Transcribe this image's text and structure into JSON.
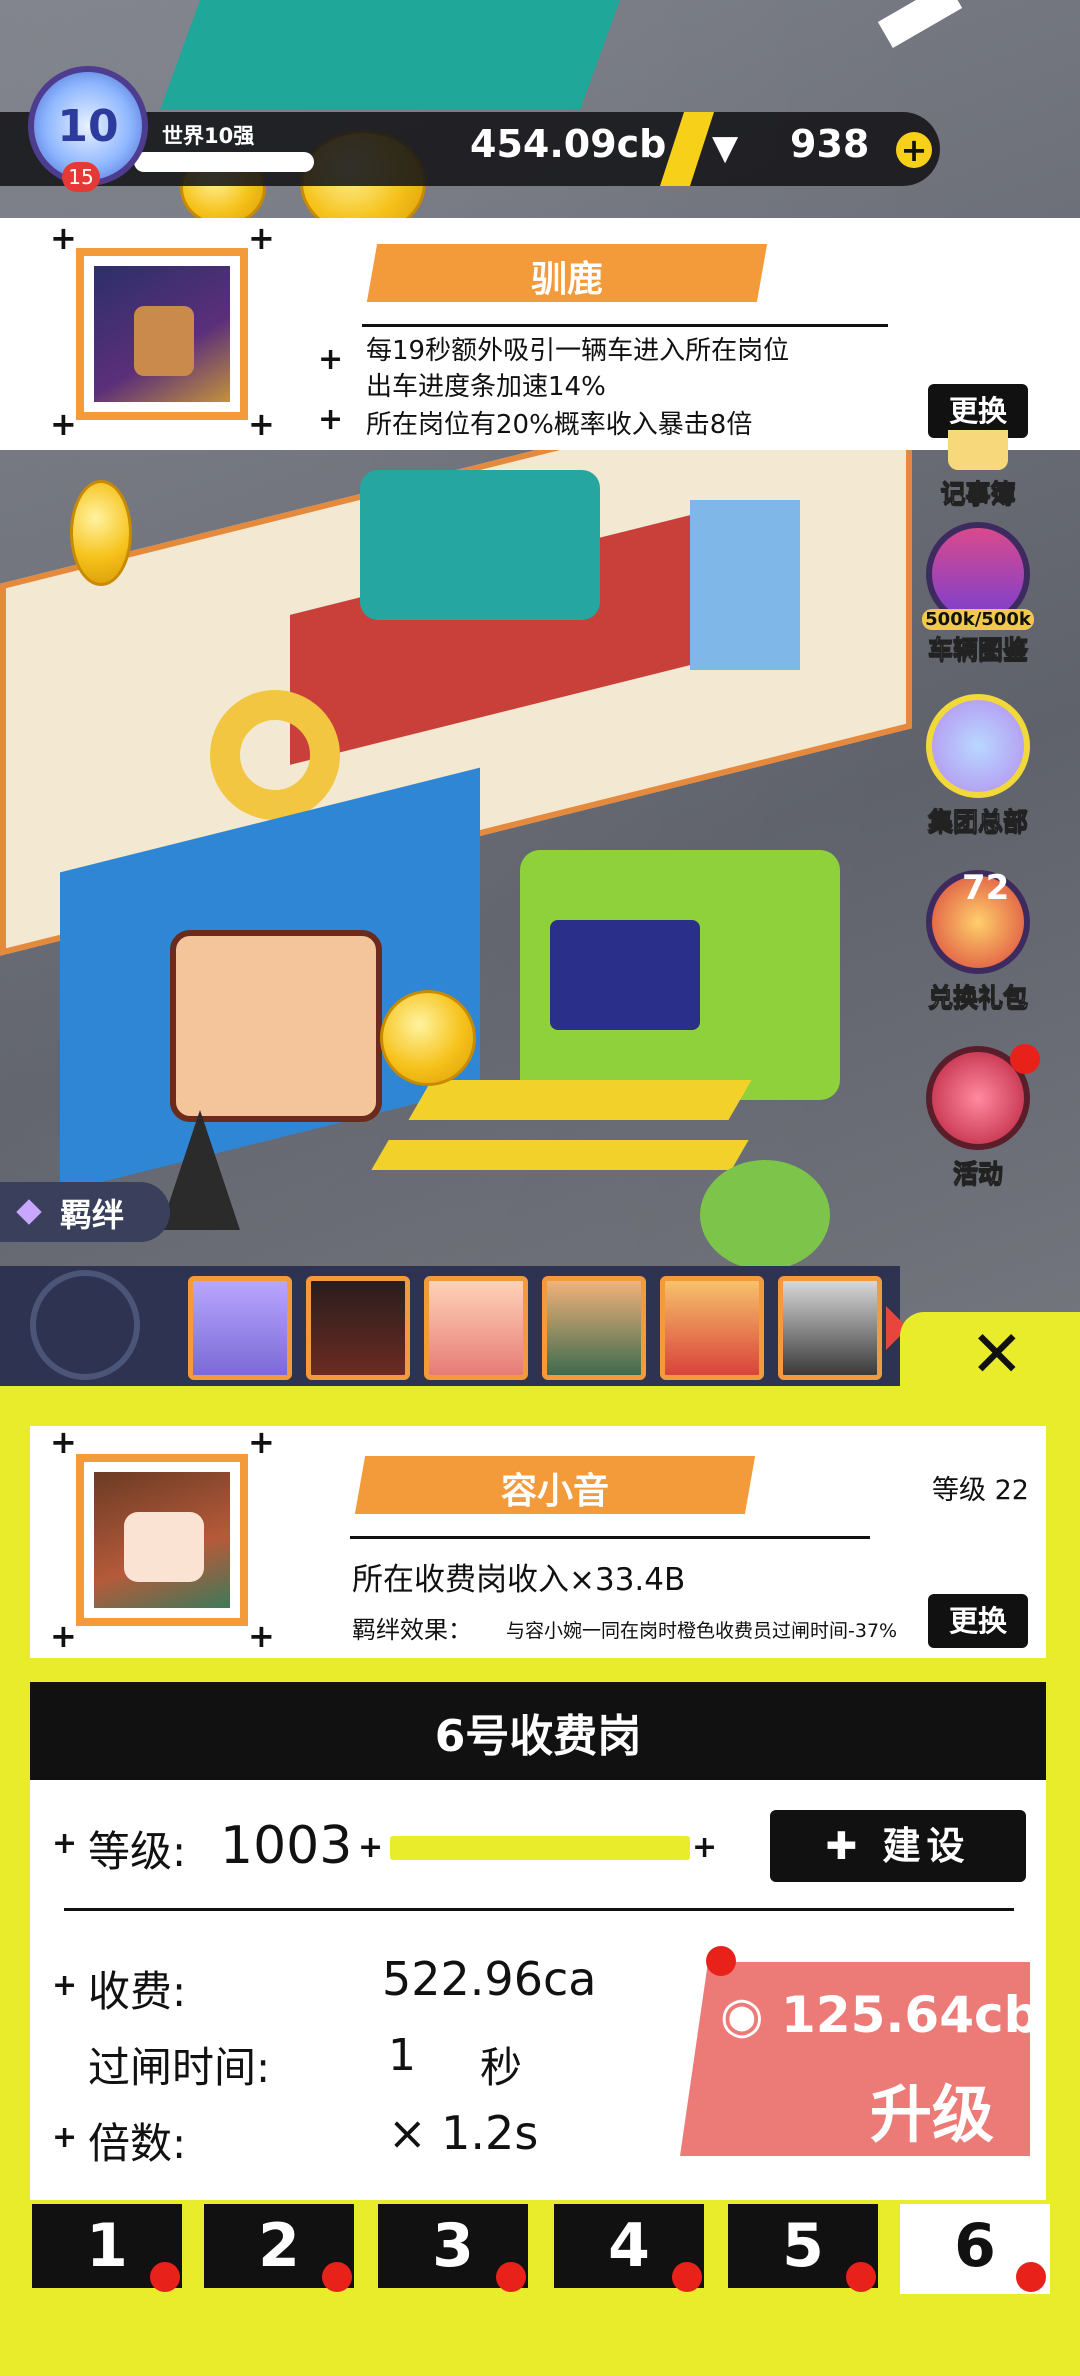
{
  "hud": {
    "level": "10",
    "level_sub": "15",
    "rank": "世界10强",
    "cash": "454.09cb",
    "gems": "938",
    "add_icon": "plus-icon",
    "gem_icon": "diamond-icon"
  },
  "pet_card": {
    "name": "驯鹿",
    "effect_1": "每19秒额外吸引一辆车进入所在岗位",
    "effect_2": "出车进度条加速14%",
    "effect_3": "所在岗位有20%概率收入暴击8倍",
    "swap_label": "更换"
  },
  "side_menu": {
    "notebook": "记事簿",
    "vehicle_book": "车辆图鉴",
    "vehicle_count": "500k/500k",
    "hq": "集团总部",
    "gift": "兑换礼包",
    "gift_badge": "72",
    "events": "活动"
  },
  "bond": {
    "label": "羁绊"
  },
  "staff_card": {
    "name": "容小音",
    "level_text": "等级 22",
    "income": "所在收费岗收入×33.4B",
    "bond_label": "羁绊效果：",
    "bond_effect": "与容小婉一同在岗时橙色收费员过闸时间-37%",
    "swap_label": "更换"
  },
  "booth": {
    "title": "6号收费岗",
    "level_label": "等级:",
    "level_value": "1003",
    "build_label": "建设",
    "fee_label": "收费:",
    "fee_value": "522.96ca",
    "gate_label": "过闸时间:",
    "gate_value": "1",
    "gate_unit": "秒",
    "multiplier_label": "倍数:",
    "multiplier_value": "× 1.2s",
    "upgrade_cost": "125.64cb",
    "upgrade_label": "升级"
  },
  "tabs": [
    "1",
    "2",
    "3",
    "4",
    "5",
    "6"
  ],
  "colors": {
    "panel": "#e8ec2b",
    "accent_orange": "#f39a3b",
    "upgrade": "#ec7b78",
    "notify": "#e8221b"
  }
}
